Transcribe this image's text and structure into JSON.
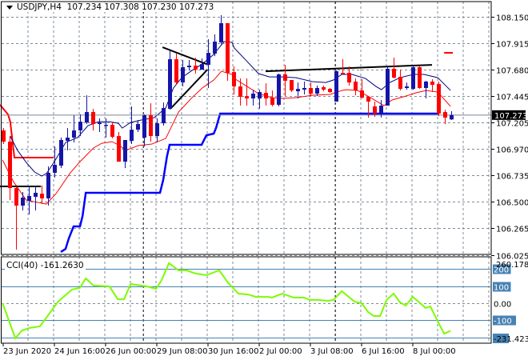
{
  "header": {
    "symbol": "USDJPY,H4",
    "ohlc": "107.234 107.308 107.230 107.273"
  },
  "colors": {
    "bull": "#1515a8",
    "bear": "#ff0000",
    "ma_fast": "#000080",
    "ma_slow": "#ff0000",
    "step_line": "#0000ff",
    "cci": "#7cfc00",
    "level": "#4682b4",
    "grid": "#7f8a99"
  },
  "chart_data": {
    "type": "candlestick",
    "symbol": "USDJPY",
    "timeframe": "H4",
    "price_axis": {
      "ticks": [
        "108.150",
        "107.915",
        "107.680",
        "107.445",
        "107.205",
        "106.970",
        "106.735",
        "106.500",
        "106.265",
        "106.025"
      ],
      "range": [
        106.025,
        108.15
      ]
    },
    "current_price": "107.273",
    "time_axis": {
      "labels": [
        "23 Jun 2020",
        "24 Jun 16:00",
        "26 Jun 00:00",
        "29 Jun 08:00",
        "30 Jun 16:00",
        "2 Jul 00:00",
        "3 Jul 08:00",
        "6 Jul 16:00",
        "8 Jul 00:00"
      ],
      "label_bars": [
        0,
        8,
        16,
        24,
        32,
        40,
        48,
        56,
        64
      ],
      "period_separator_bars": [
        21.9,
        51.9
      ]
    },
    "candles": [
      [
        107.136,
        107.157,
        107.015,
        107.036
      ],
      [
        107.036,
        107.086,
        106.516,
        106.623
      ],
      [
        106.623,
        106.638,
        106.075,
        106.467
      ],
      [
        106.467,
        106.588,
        106.424,
        106.538
      ],
      [
        106.509,
        106.645,
        106.388,
        106.552
      ],
      [
        106.545,
        106.638,
        106.424,
        106.581
      ],
      [
        106.573,
        106.645,
        106.481,
        106.531
      ],
      [
        106.531,
        106.816,
        106.467,
        106.759
      ],
      [
        106.759,
        106.994,
        106.716,
        106.83
      ],
      [
        106.823,
        107.072,
        106.801,
        107.051
      ],
      [
        107.043,
        107.157,
        106.958,
        107.072
      ],
      [
        107.072,
        107.271,
        107.029,
        107.136
      ],
      [
        107.136,
        107.279,
        107.086,
        107.214
      ],
      [
        107.207,
        107.449,
        107.193,
        107.3
      ],
      [
        107.3,
        107.328,
        107.136,
        107.193
      ],
      [
        107.193,
        107.243,
        107.122,
        107.207
      ],
      [
        107.179,
        107.243,
        107.072,
        107.186
      ],
      [
        107.186,
        107.214,
        107.065,
        107.079
      ],
      [
        107.086,
        107.122,
        106.858,
        106.858
      ],
      [
        106.858,
        107.051,
        106.801,
        107.051
      ],
      [
        107.043,
        107.35,
        107.015,
        107.143
      ],
      [
        107.143,
        107.229,
        107.122,
        107.193
      ],
      [
        107.072,
        107.279,
        106.994,
        107.271
      ],
      [
        107.271,
        107.378,
        107.036,
        107.086
      ],
      [
        107.086,
        107.243,
        107.036,
        107.2
      ],
      [
        107.2,
        107.385,
        107.179,
        107.336
      ],
      [
        107.328,
        107.848,
        107.321,
        107.77
      ],
      [
        107.77,
        107.82,
        107.542,
        107.563
      ],
      [
        107.563,
        107.763,
        107.528,
        107.699
      ],
      [
        107.699,
        107.763,
        107.67,
        107.713
      ],
      [
        107.713,
        107.784,
        107.642,
        107.677
      ],
      [
        107.677,
        107.777,
        107.677,
        107.727
      ],
      [
        107.72,
        107.948,
        107.514,
        107.827
      ],
      [
        107.82,
        107.991,
        107.798,
        107.927
      ],
      [
        107.92,
        108.162,
        107.905,
        108.091
      ],
      [
        108.091,
        108.091,
        107.578,
        107.649
      ],
      [
        107.656,
        107.706,
        107.457,
        107.528
      ],
      [
        107.528,
        107.599,
        107.357,
        107.435
      ],
      [
        107.442,
        107.599,
        107.357,
        107.421
      ],
      [
        107.421,
        107.499,
        107.357,
        107.464
      ],
      [
        107.421,
        107.499,
        107.328,
        107.478
      ],
      [
        107.471,
        107.556,
        107.357,
        107.421
      ],
      [
        107.428,
        107.492,
        107.35,
        107.364
      ],
      [
        107.364,
        107.642,
        107.35,
        107.635
      ],
      [
        107.635,
        107.72,
        107.442,
        107.578
      ],
      [
        107.585,
        107.585,
        107.478,
        107.492
      ],
      [
        107.485,
        107.563,
        107.421,
        107.506
      ],
      [
        107.499,
        107.571,
        107.457,
        107.514
      ],
      [
        107.514,
        107.563,
        107.442,
        107.464
      ],
      [
        107.464,
        107.535,
        107.442,
        107.514
      ],
      [
        107.521,
        107.535,
        107.485,
        107.499
      ],
      [
        107.506,
        107.514,
        107.471,
        107.478
      ],
      [
        107.393,
        107.67,
        107.393,
        107.663
      ],
      [
        107.649,
        107.77,
        107.635,
        107.642
      ],
      [
        107.649,
        107.706,
        107.535,
        107.563
      ],
      [
        107.571,
        107.599,
        107.449,
        107.492
      ],
      [
        107.492,
        107.592,
        107.421,
        107.428
      ],
      [
        107.435,
        107.442,
        107.25,
        107.393
      ],
      [
        107.35,
        107.393,
        107.257,
        107.286
      ],
      [
        107.286,
        107.407,
        107.25,
        107.357
      ],
      [
        107.357,
        107.706,
        107.357,
        107.685
      ],
      [
        107.685,
        107.784,
        107.599,
        107.606
      ],
      [
        107.613,
        107.677,
        107.492,
        107.506
      ],
      [
        107.514,
        107.563,
        107.499,
        107.528
      ],
      [
        107.506,
        107.706,
        107.499,
        107.699
      ],
      [
        107.699,
        107.706,
        107.506,
        107.514
      ],
      [
        107.514,
        107.578,
        107.421,
        107.571
      ],
      [
        107.571,
        107.592,
        107.478,
        107.542
      ],
      [
        107.549,
        107.571,
        107.264,
        107.286
      ],
      [
        107.3,
        107.321,
        107.193,
        107.25
      ],
      [
        107.234,
        107.308,
        107.23,
        107.273
      ]
    ],
    "overlays": {
      "ma_fast": [
        [
          1.1,
          107.086
        ],
        [
          2.25,
          106.958
        ],
        [
          3.6,
          106.851
        ],
        [
          4.9,
          106.766
        ],
        [
          6,
          106.73
        ],
        [
          6.75,
          106.752
        ],
        [
          8,
          106.858
        ],
        [
          9.75,
          107.029
        ],
        [
          11.6,
          107.072
        ],
        [
          13.25,
          107.179
        ],
        [
          14.9,
          107.214
        ],
        [
          16.6,
          107.214
        ],
        [
          18,
          107.2
        ],
        [
          18.6,
          107.157
        ],
        [
          19.9,
          107.207
        ],
        [
          21.6,
          107.229
        ],
        [
          23.6,
          107.25
        ],
        [
          25.4,
          107.336
        ],
        [
          26.6,
          107.514
        ],
        [
          27.9,
          107.606
        ],
        [
          29.5,
          107.67
        ],
        [
          31.1,
          107.727
        ],
        [
          32.9,
          107.813
        ],
        [
          34.5,
          107.927
        ],
        [
          35.75,
          107.92
        ],
        [
          36.1,
          107.87
        ],
        [
          37.9,
          107.763
        ],
        [
          39.9,
          107.642
        ],
        [
          41.6,
          107.613
        ],
        [
          43.6,
          107.613
        ],
        [
          45.75,
          107.606
        ],
        [
          48.25,
          107.571
        ],
        [
          50.4,
          107.563
        ],
        [
          51.6,
          107.585
        ],
        [
          52.9,
          107.635
        ],
        [
          54.5,
          107.635
        ],
        [
          56.6,
          107.599
        ],
        [
          58.25,
          107.528
        ],
        [
          59.1,
          107.499
        ],
        [
          60.4,
          107.563
        ],
        [
          62,
          107.606
        ],
        [
          64.1,
          107.635
        ],
        [
          65.75,
          107.635
        ],
        [
          67.9,
          107.606
        ],
        [
          69.9,
          107.492
        ]
      ],
      "ma_slow": [
        [
          -0.1,
          106.873
        ],
        [
          1.6,
          106.68
        ],
        [
          3.6,
          106.516
        ],
        [
          5.4,
          106.495
        ],
        [
          6.75,
          106.481
        ],
        [
          8.25,
          106.573
        ],
        [
          10.4,
          106.752
        ],
        [
          12,
          106.858
        ],
        [
          14.1,
          106.98
        ],
        [
          15.4,
          107.022
        ],
        [
          17,
          107.036
        ],
        [
          18.25,
          107.001
        ],
        [
          19.1,
          106.958
        ],
        [
          21.1,
          107.001
        ],
        [
          23.25,
          107.015
        ],
        [
          25.4,
          107.065
        ],
        [
          27.4,
          107.3
        ],
        [
          29.5,
          107.428
        ],
        [
          31.1,
          107.514
        ],
        [
          32.9,
          107.585
        ],
        [
          34.1,
          107.663
        ],
        [
          35.75,
          107.635
        ],
        [
          36.1,
          107.599
        ],
        [
          37.9,
          107.535
        ],
        [
          39.9,
          107.464
        ],
        [
          42,
          107.428
        ],
        [
          43.6,
          107.421
        ],
        [
          45.75,
          107.428
        ],
        [
          48.25,
          107.449
        ],
        [
          51.1,
          107.457
        ],
        [
          52.9,
          107.492
        ],
        [
          53.6,
          107.499
        ],
        [
          55.4,
          107.492
        ],
        [
          57.4,
          107.428
        ],
        [
          59.5,
          107.357
        ],
        [
          60.75,
          107.407
        ],
        [
          62.9,
          107.442
        ],
        [
          64.5,
          107.471
        ],
        [
          66.1,
          107.492
        ],
        [
          67.9,
          107.478
        ],
        [
          69.9,
          107.35
        ]
      ],
      "step_line": [
        [
          9,
          106.054
        ],
        [
          9.75,
          106.082
        ],
        [
          10.25,
          106.175
        ],
        [
          11,
          106.282
        ],
        [
          12,
          106.282
        ],
        [
          12.4,
          106.374
        ],
        [
          12.9,
          106.581
        ],
        [
          24.5,
          106.581
        ],
        [
          25,
          106.695
        ],
        [
          25.6,
          106.908
        ],
        [
          26,
          107.008
        ],
        [
          31,
          107.008
        ],
        [
          31.75,
          107.093
        ],
        [
          32.9,
          107.108
        ],
        [
          33.25,
          107.157
        ],
        [
          33.9,
          107.286
        ],
        [
          68,
          107.286
        ]
      ],
      "red_step_line": [
        [
          -0.5,
          107.364
        ],
        [
          0.75,
          107.279
        ],
        [
          1.1,
          107.214
        ],
        [
          1.75,
          106.894
        ],
        [
          7.9,
          106.894
        ]
      ],
      "marker": [
        [
          68.9,
          107.827
        ],
        [
          70.25,
          107.827
        ]
      ]
    },
    "trendlines": [
      [
        [
          -0.5,
          106.638
        ],
        [
          5.9,
          106.638
        ]
      ],
      [
        [
          24.9,
          107.877
        ],
        [
          31.75,
          107.727
        ]
      ],
      [
        [
          26.25,
          107.336
        ],
        [
          31.9,
          107.677
        ]
      ],
      [
        [
          41,
          107.663
        ],
        [
          67,
          107.72
        ]
      ]
    ],
    "cci": {
      "name": "CCI(40)",
      "current": "-161.2630",
      "max_label": "260.1783",
      "min_label": "-231.4239",
      "levels": [
        {
          "value": 200,
          "label": "200"
        },
        {
          "value": 100,
          "label": "100"
        },
        {
          "value": 0,
          "label": "0.00"
        },
        {
          "value": -100,
          "label": "-100"
        },
        {
          "value": -200,
          "label": ""
        }
      ],
      "values": [
        [
          -0.1,
          0
        ],
        [
          1.9,
          -205
        ],
        [
          2.9,
          -160
        ],
        [
          4.1,
          -145
        ],
        [
          5.75,
          -135
        ],
        [
          8.6,
          10
        ],
        [
          10.75,
          80
        ],
        [
          12,
          90
        ],
        [
          12.9,
          145
        ],
        [
          14.1,
          103
        ],
        [
          16.6,
          98
        ],
        [
          17.9,
          23
        ],
        [
          18.9,
          23
        ],
        [
          19.9,
          112
        ],
        [
          22.4,
          98
        ],
        [
          23.9,
          84
        ],
        [
          24.75,
          135
        ],
        [
          25.9,
          234
        ],
        [
          27.4,
          192
        ],
        [
          28.6,
          192
        ],
        [
          30.1,
          173
        ],
        [
          31.75,
          164
        ],
        [
          33.75,
          192
        ],
        [
          35.1,
          121
        ],
        [
          36.75,
          56
        ],
        [
          38.25,
          51
        ],
        [
          39.5,
          37
        ],
        [
          41.4,
          37
        ],
        [
          42,
          33
        ],
        [
          43.6,
          56
        ],
        [
          45.4,
          33
        ],
        [
          47,
          33
        ],
        [
          47.9,
          19
        ],
        [
          49.1,
          19
        ],
        [
          50.75,
          14
        ],
        [
          51.6,
          19
        ],
        [
          52.9,
          70
        ],
        [
          54.9,
          9
        ],
        [
          56,
          0
        ],
        [
          57,
          -51
        ],
        [
          57.9,
          -75
        ],
        [
          58.9,
          -75
        ],
        [
          59.9,
          19
        ],
        [
          61,
          56
        ],
        [
          62,
          5
        ],
        [
          62.9,
          -14
        ],
        [
          64,
          37
        ],
        [
          64.9,
          9
        ],
        [
          66,
          -28
        ],
        [
          66.75,
          -19
        ],
        [
          67.9,
          -107
        ],
        [
          68.9,
          -178
        ],
        [
          69.9,
          -161.263
        ]
      ]
    }
  }
}
